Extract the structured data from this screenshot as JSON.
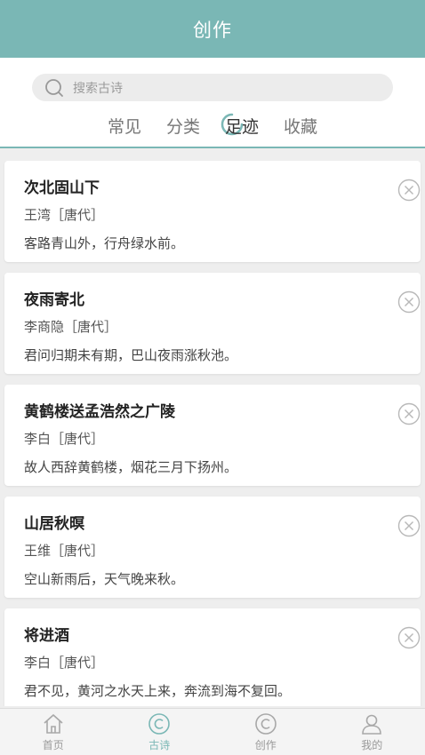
{
  "header": {
    "title": "创作"
  },
  "search": {
    "placeholder": "搜索古诗"
  },
  "tabs": [
    {
      "label": "常见"
    },
    {
      "label": "分类"
    },
    {
      "label": "足迹"
    },
    {
      "label": "收藏"
    }
  ],
  "active_tab": "足迹",
  "poems": [
    {
      "title": "次北固山下",
      "author": "王湾［唐代］",
      "line": "客路青山外，行舟绿水前。"
    },
    {
      "title": "夜雨寄北",
      "author": "李商隐［唐代］",
      "line": "君问归期未有期，巴山夜雨涨秋池。"
    },
    {
      "title": "黄鹤楼送孟浩然之广陵",
      "author": "李白［唐代］",
      "line": "故人西辞黄鹤楼，烟花三月下扬州。"
    },
    {
      "title": "山居秋暝",
      "author": "王维［唐代］",
      "line": "空山新雨后，天气晚来秋。"
    },
    {
      "title": "将进酒",
      "author": "李白［唐代］",
      "line": "君不见，黄河之水天上来，奔流到海不复回。"
    }
  ],
  "nav": [
    {
      "label": "首页",
      "icon": "home-icon"
    },
    {
      "label": "古诗",
      "icon": "copyright-icon"
    },
    {
      "label": "创作",
      "icon": "copyright-icon"
    },
    {
      "label": "我的",
      "icon": "user-icon"
    }
  ],
  "colors": {
    "accent": "#7ab7b5",
    "background": "#eeeeee"
  }
}
